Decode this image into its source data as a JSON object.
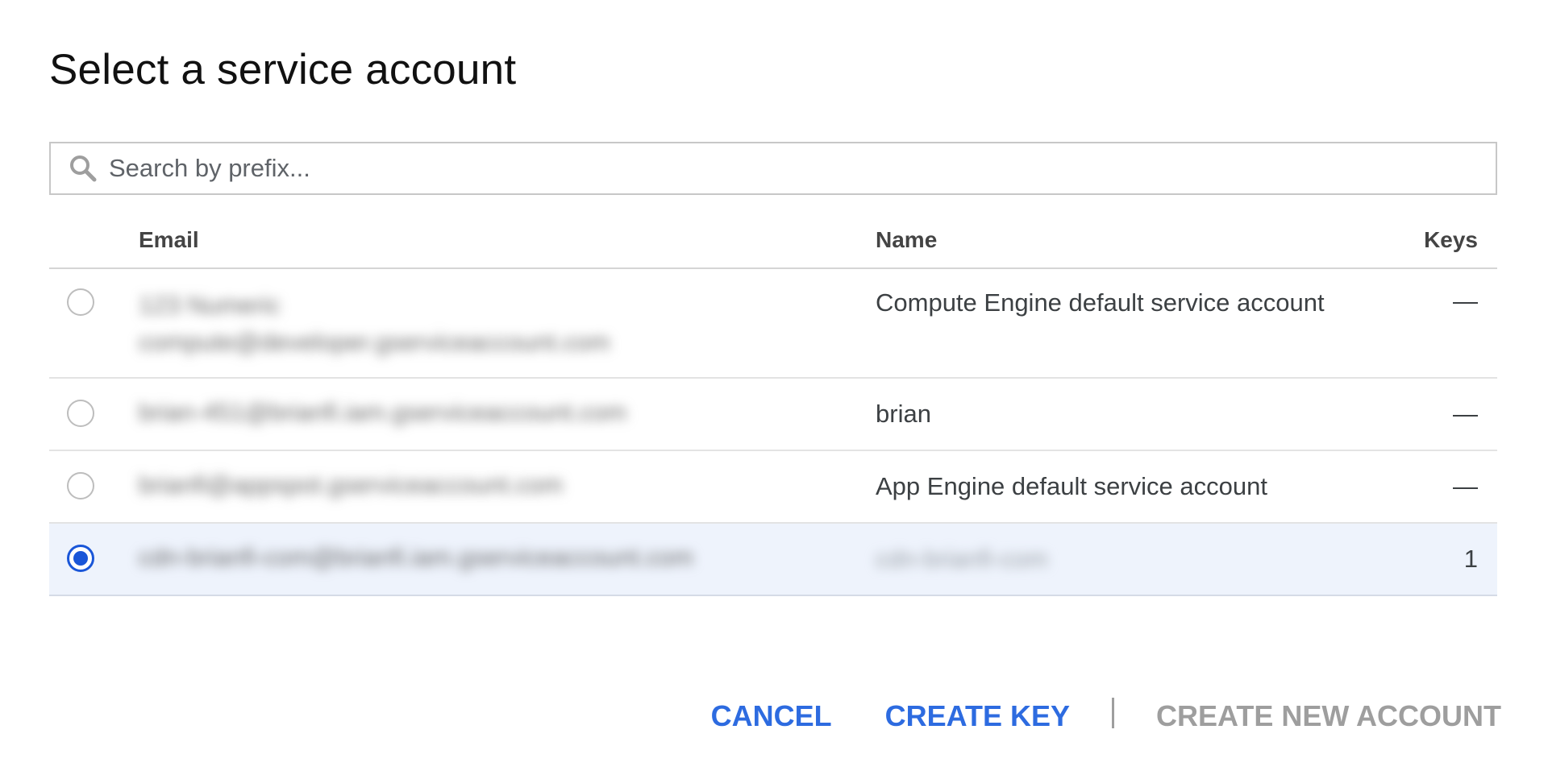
{
  "dialog": {
    "title": "Select a service account"
  },
  "search": {
    "placeholder": "Search by prefix...",
    "value": ""
  },
  "table": {
    "headers": {
      "email": "Email",
      "name": "Name",
      "keys": "Keys"
    },
    "rows": [
      {
        "email_lines": [
          "123 Numeric",
          "compute@developer.gserviceaccount.com"
        ],
        "name": "Compute Engine default service account",
        "keys": "—",
        "selected": false
      },
      {
        "email_lines": [
          "brian-451@brianfi.iam.gserviceaccount.com"
        ],
        "name": "brian",
        "keys": "—",
        "selected": false
      },
      {
        "email_lines": [
          "brianfi@appspot.gserviceaccount.com"
        ],
        "name": "App Engine default service account",
        "keys": "—",
        "selected": false
      },
      {
        "email_lines": [
          "cdn-brianfi-com@brianfi.iam.gserviceaccount.com"
        ],
        "name": "cdn-brianfi-com",
        "name_blurred": true,
        "keys": "1",
        "selected": true
      }
    ]
  },
  "actions": {
    "cancel": "CANCEL",
    "create_key": "CREATE KEY",
    "create_new_account": "CREATE NEW ACCOUNT"
  },
  "colors": {
    "accent": "#2d6be0",
    "radio_selected": "#1a56d8",
    "selected_row_bg": "#eef3fc",
    "disabled_text": "#9e9e9e"
  }
}
